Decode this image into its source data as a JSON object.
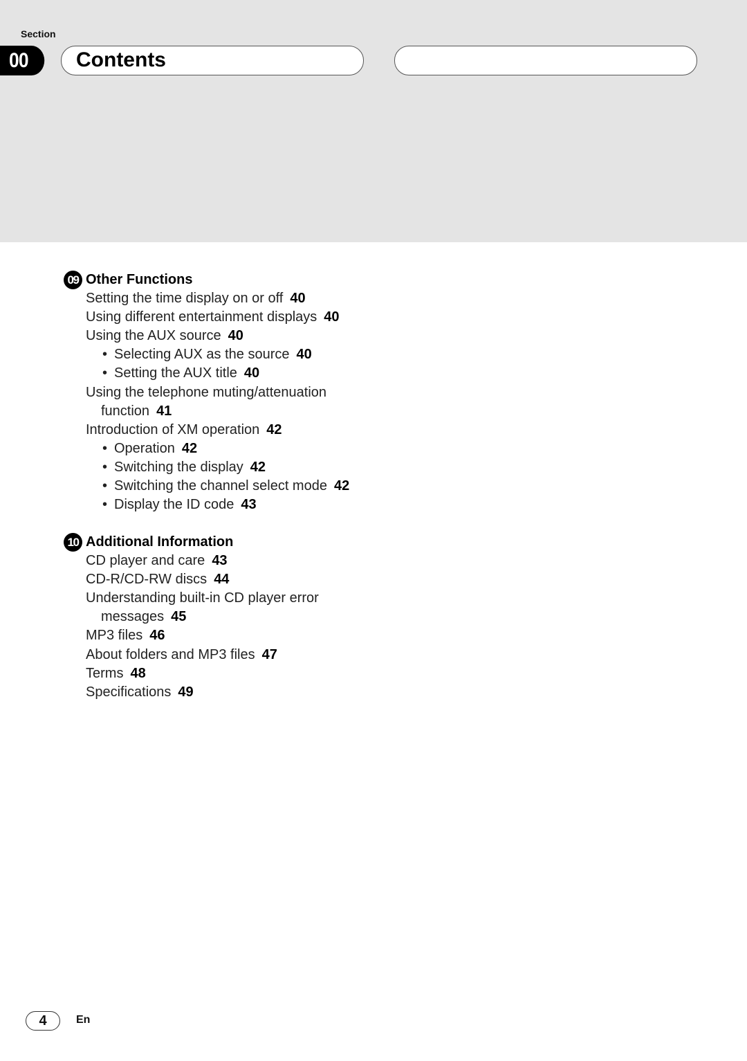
{
  "header": {
    "section_label": "Section",
    "section_number": "00",
    "title": "Contents"
  },
  "chapters": [
    {
      "number": "09",
      "title": "Other Functions",
      "entries": [
        {
          "text": "Setting the time display on or off",
          "page": "40",
          "level": 1
        },
        {
          "text": "Using different entertainment displays",
          "page": "40",
          "level": 1
        },
        {
          "text": "Using the AUX source",
          "page": "40",
          "level": 1
        },
        {
          "text": "Selecting AUX as the source",
          "page": "40",
          "level": 2
        },
        {
          "text": "Setting the AUX title",
          "page": "40",
          "level": 2
        },
        {
          "text": "Using the telephone muting/attenuation",
          "continuation": "function",
          "page": "41",
          "level": 1
        },
        {
          "text": "Introduction of XM operation",
          "page": "42",
          "level": 1
        },
        {
          "text": "Operation",
          "page": "42",
          "level": 2
        },
        {
          "text": "Switching the display",
          "page": "42",
          "level": 2
        },
        {
          "text": "Switching the channel select mode",
          "page": "42",
          "level": 2
        },
        {
          "text": "Display the ID code",
          "page": "43",
          "level": 2
        }
      ]
    },
    {
      "number": "10",
      "title": "Additional Information",
      "entries": [
        {
          "text": "CD player and care",
          "page": "43",
          "level": 1
        },
        {
          "text": "CD-R/CD-RW discs",
          "page": "44",
          "level": 1
        },
        {
          "text": "Understanding built-in CD player error",
          "continuation": "messages",
          "page": "45",
          "level": 1
        },
        {
          "text": "MP3 files",
          "page": "46",
          "level": 1
        },
        {
          "text": "About folders and MP3 files",
          "page": "47",
          "level": 1
        },
        {
          "text": "Terms",
          "page": "48",
          "level": 1
        },
        {
          "text": "Specifications",
          "page": "49",
          "level": 1
        }
      ]
    }
  ],
  "footer": {
    "page_number": "4",
    "language": "En"
  },
  "icons": {
    "bullet": "•"
  }
}
